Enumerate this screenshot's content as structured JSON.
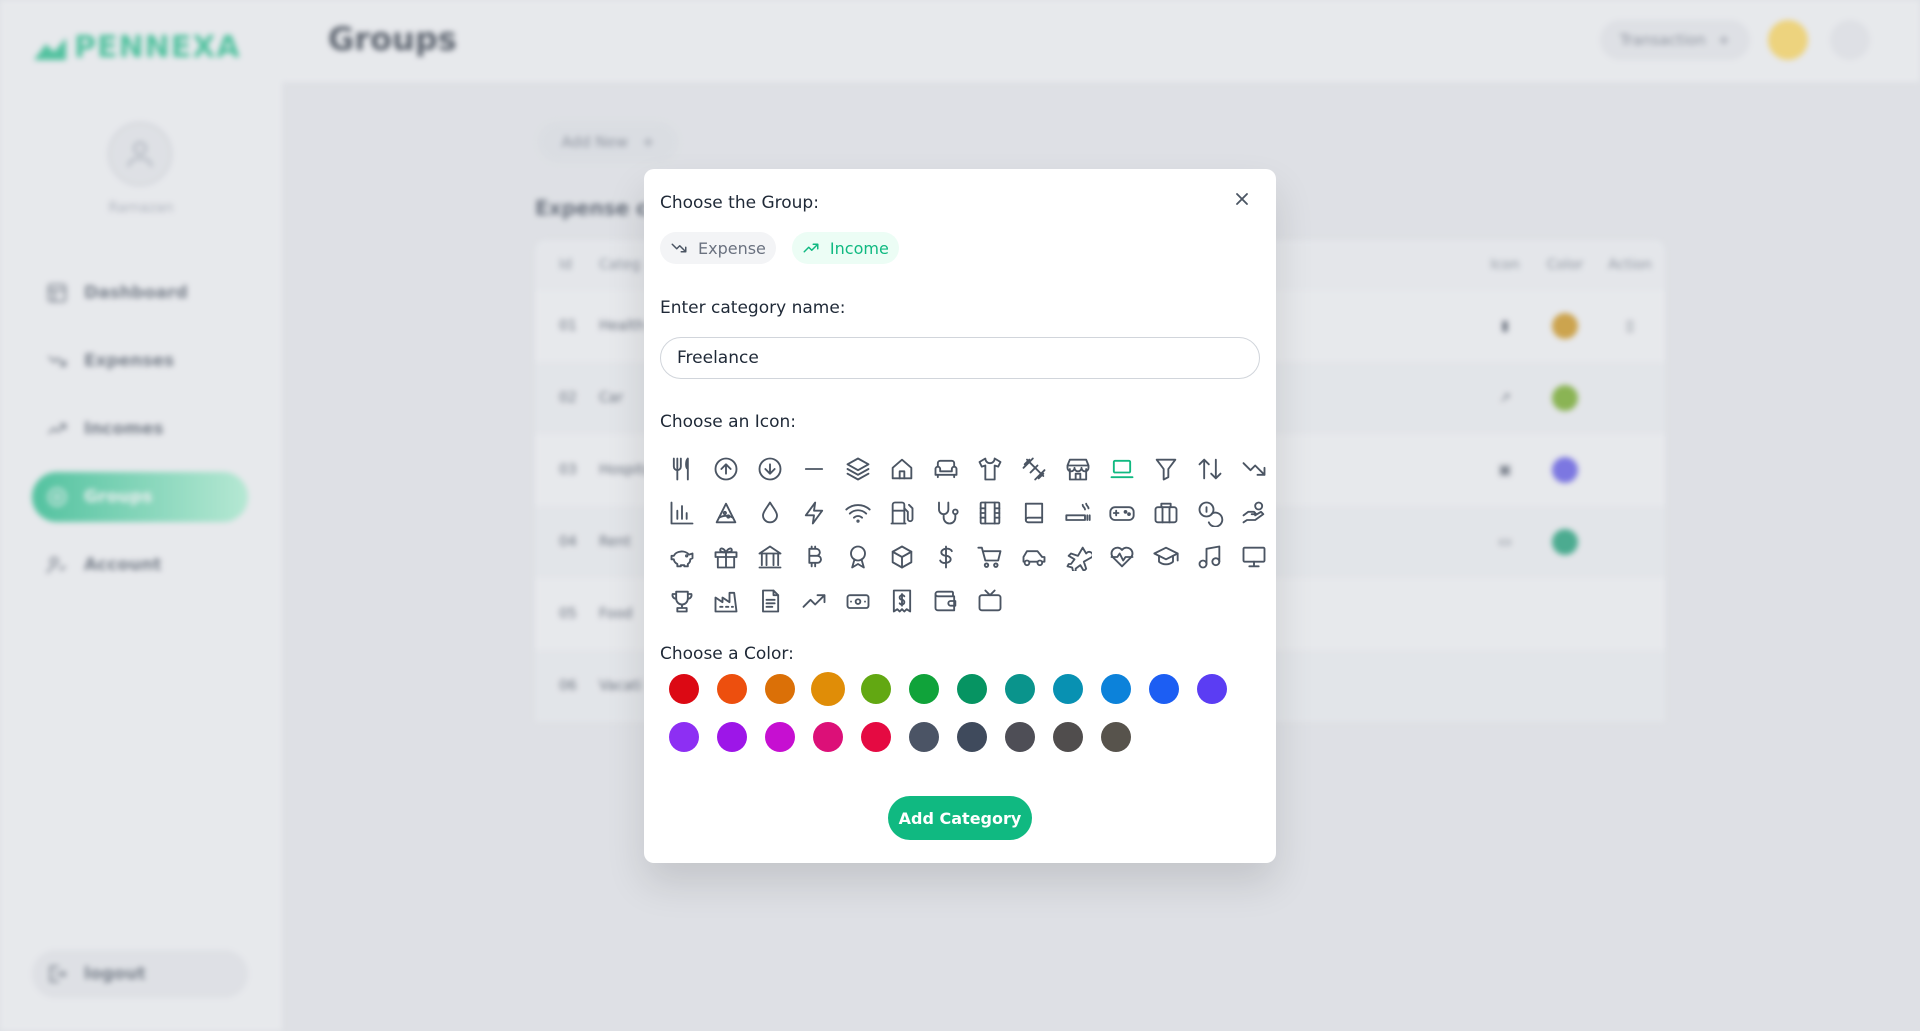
{
  "app": {
    "logo_text": "PENNEXA",
    "user_name": "Ramazan",
    "page_title": "Groups",
    "transaction_button": "Transaction",
    "nav": [
      {
        "label": "Dashboard",
        "icon": "dashboard-icon"
      },
      {
        "label": "Expenses",
        "icon": "trending-down-icon"
      },
      {
        "label": "Incomes",
        "icon": "trending-up-icon"
      },
      {
        "label": "Groups",
        "icon": "groups-icon",
        "active": true
      },
      {
        "label": "Account",
        "icon": "account-icon"
      }
    ],
    "logout_label": "logout",
    "add_new_label": "Add New",
    "section_title": "Expense ca",
    "right_title": ")",
    "table_headers": {
      "id": "Id",
      "name": "Categ",
      "icon": "Icon",
      "color": "Color",
      "action": "Action"
    },
    "table_rows": [
      {
        "id": "01",
        "name": "Health",
        "icon": "pill-icon",
        "color": "#ca8a04"
      },
      {
        "id": "02",
        "name": "Car",
        "icon": "trending-up-icon",
        "color": "#65a30d"
      },
      {
        "id": "03",
        "name": "Hospital",
        "icon": "box-icon",
        "color": "#4f46e5"
      },
      {
        "id": "04",
        "name": "Rent",
        "icon": "cash-icon",
        "color": "#059669"
      },
      {
        "id": "05",
        "name": "Food",
        "icon": "",
        "color": ""
      },
      {
        "id": "06",
        "name": "Vacati",
        "icon": "",
        "color": ""
      }
    ]
  },
  "modal": {
    "group_label": "Choose the Group:",
    "groups": [
      {
        "label": "Expense",
        "icon": "trending-down-icon",
        "selected": false
      },
      {
        "label": "Income",
        "icon": "trending-up-icon",
        "selected": true
      }
    ],
    "name_label": "Enter category name:",
    "name_value": "Freelance",
    "icon_label": "Choose an Icon:",
    "icons": [
      "tools-kitchen-icon",
      "arrow-up-circle-icon",
      "arrow-down-circle-icon",
      "minus-icon",
      "layers-icon",
      "home-icon",
      "sofa-icon",
      "shirt-icon",
      "barbell-icon",
      "store-icon",
      "laptop-icon",
      "filter-icon",
      "arrows-sort-icon",
      "trending-down-icon",
      "bar-chart-icon",
      "pizza-icon",
      "droplet-icon",
      "bolt-icon",
      "wifi-icon",
      "gas-station-icon",
      "stethoscope-icon",
      "film-icon",
      "book-icon",
      "smoking-icon",
      "gamepad-icon",
      "briefcase-icon",
      "coins-icon",
      "hand-coin-icon",
      "piggy-bank-icon",
      "gift-icon",
      "bank-icon",
      "bitcoin-icon",
      "award-icon",
      "box-icon",
      "dollar-icon",
      "shopping-cart-icon",
      "car-icon",
      "plane-icon",
      "heart-rate-icon",
      "graduation-cap-icon",
      "music-icon",
      "monitor-icon",
      "trophy-icon",
      "factory-icon",
      "document-icon",
      "trending-up-icon",
      "cash-icon",
      "receipt-icon",
      "wallet-icon",
      "tv-icon"
    ],
    "selected_icon": "laptop-icon",
    "color_label": "Choose a Color:",
    "colors": [
      "#dc0914",
      "#ed4f0e",
      "#db7007",
      "#e08d07",
      "#62a812",
      "#10a33a",
      "#069462",
      "#0a948c",
      "#0891b2",
      "#0c82da",
      "#1c5ef3",
      "#5b3df3",
      "#8d2ff3",
      "#9d16e8",
      "#c60fd1",
      "#dc1078",
      "#e50a42",
      "#4b5465",
      "#3f4a5c",
      "#4e4e56",
      "#504d4d",
      "#57534c"
    ],
    "selected_color": "#e08d07",
    "submit_label": "Add Category"
  }
}
